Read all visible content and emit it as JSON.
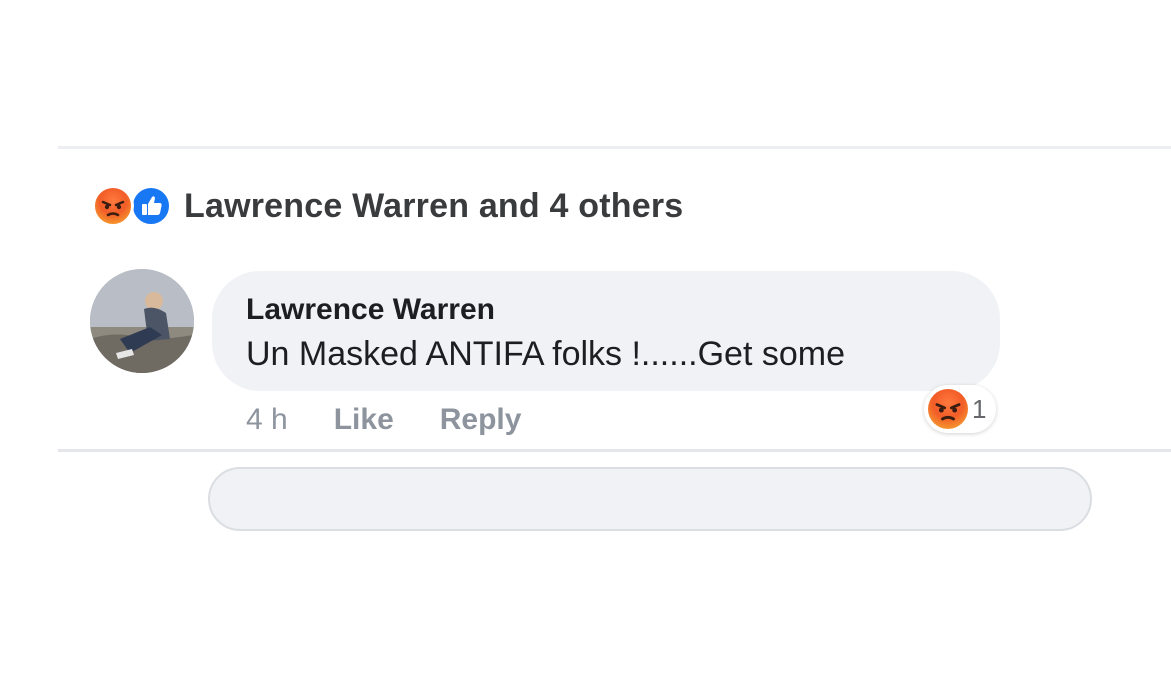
{
  "reactions_summary": {
    "icons": [
      "angry-icon",
      "like-icon"
    ],
    "text": "Lawrence Warren and 4 others"
  },
  "comment": {
    "author": "Lawrence Warren",
    "text": "Un Masked ANTIFA folks !......Get some",
    "time": "4 h",
    "like_label": "Like",
    "reply_label": "Reply",
    "reaction": {
      "icon": "angry-icon",
      "count": "1"
    }
  },
  "colors": {
    "like_blue": "#1877f2",
    "angry_orange": "#f25c28",
    "bubble_gray": "#f0f2f5",
    "meta_gray": "#8d949e"
  }
}
